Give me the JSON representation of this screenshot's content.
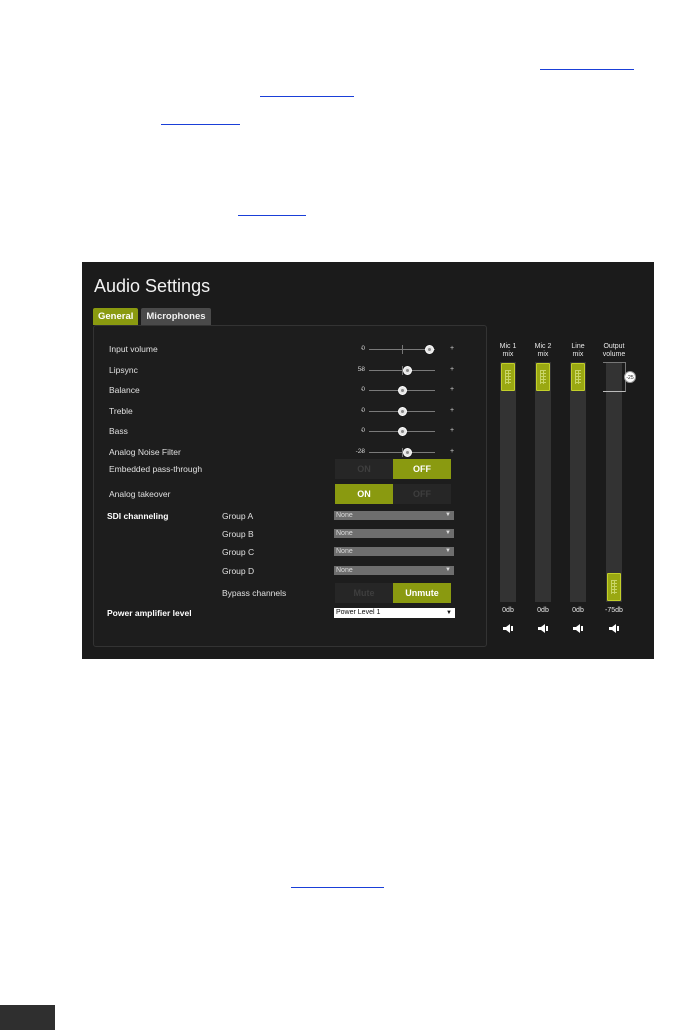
{
  "panel": {
    "title": "Audio Settings",
    "tabs": [
      {
        "label": "General",
        "active": true
      },
      {
        "label": "Microphones",
        "active": false
      }
    ]
  },
  "sliders": [
    {
      "label": "Input volume",
      "value": "0",
      "position": 0.91
    },
    {
      "label": "Lipsync",
      "value": "58",
      "position": 0.58
    },
    {
      "label": "Balance",
      "value": "0",
      "position": 0.5
    },
    {
      "label": "Treble",
      "value": "0",
      "position": 0.5
    },
    {
      "label": "Bass",
      "value": "0",
      "position": 0.5
    },
    {
      "label": "Analog Noise Filter",
      "value": "-28",
      "position": 0.58
    }
  ],
  "toggles": {
    "embedded": {
      "label": "Embedded pass-through",
      "on": "ON",
      "off": "OFF",
      "state": "OFF"
    },
    "analog": {
      "label": "Analog takeover",
      "on": "ON",
      "off": "OFF",
      "state": "ON"
    },
    "bypass": {
      "label": "Bypass channels",
      "mute": "Mute",
      "unmute": "Unmute",
      "state": "Unmute"
    }
  },
  "sdi": {
    "label": "SDI channeling",
    "groups": [
      {
        "label": "Group A",
        "value": "None"
      },
      {
        "label": "Group B",
        "value": "None"
      },
      {
        "label": "Group C",
        "value": "None"
      },
      {
        "label": "Group D",
        "value": "None"
      }
    ]
  },
  "power": {
    "label": "Power amplifier level",
    "value": "Power Level 1"
  },
  "mixers": [
    {
      "label1": "Mic 1",
      "label2": "mix",
      "db": "0db",
      "level": 1.0
    },
    {
      "label1": "Mic 2",
      "label2": "mix",
      "db": "0db",
      "level": 1.0
    },
    {
      "label1": "Line",
      "label2": "mix",
      "db": "0db",
      "level": 1.0
    },
    {
      "label1": "Output",
      "label2": "volume",
      "db": "-75db",
      "level": 0.0,
      "bubble": "-25"
    }
  ],
  "colors": {
    "accent": "#8a9a10",
    "panel_bg": "#1b1b1b"
  }
}
